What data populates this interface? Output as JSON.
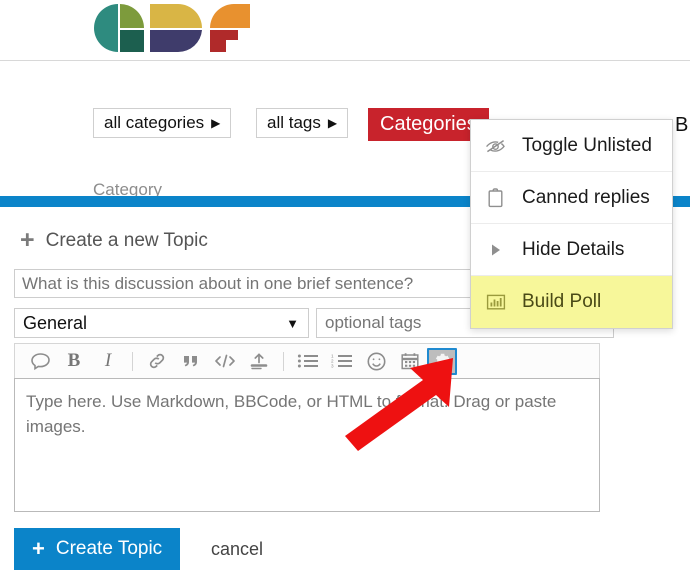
{
  "header": {
    "logo_name": "forum-logo",
    "logo_colors": [
      "#2e8b7f",
      "#7d9b3c",
      "#d9b545",
      "#e8912f",
      "#3f3c6b",
      "#b02a2a",
      "#1c5f4f"
    ]
  },
  "filter_bar": {
    "all_categories": {
      "label": "all categories",
      "caret": "▶"
    },
    "all_tags": {
      "label": "all tags",
      "caret": "▶"
    },
    "active_tab": {
      "label": "Categories",
      "color": "#c8232c"
    },
    "next_tab_partial": "B"
  },
  "list_header": {
    "category_label": "Category"
  },
  "composer": {
    "accent_color": "#0b84c9",
    "heading": "Create a new Topic",
    "heading_plus": "+",
    "title_input": {
      "value": "",
      "placeholder": "What is this discussion about in one brief sentence?"
    },
    "category_select": {
      "value": "General",
      "caret": "▼"
    },
    "tags_input": {
      "value": "",
      "placeholder": "optional tags"
    },
    "editor": {
      "value": "",
      "placeholder": "Type here. Use Markdown, BBCode, or HTML to format. Drag or paste images."
    },
    "toolbar": [
      {
        "name": "quote-bubble-icon",
        "title": "blockquote bubble"
      },
      {
        "name": "bold-icon",
        "title": "Bold",
        "glyph": "B"
      },
      {
        "name": "italic-icon",
        "title": "Italic",
        "glyph": "I"
      },
      {
        "name": "link-icon",
        "title": "Link"
      },
      {
        "name": "quote-icon",
        "title": "Quote"
      },
      {
        "name": "code-icon",
        "title": "Code"
      },
      {
        "name": "upload-icon",
        "title": "Upload"
      },
      {
        "name": "bulleted-list-icon",
        "title": "Bulleted list"
      },
      {
        "name": "numbered-list-icon",
        "title": "Numbered list"
      },
      {
        "name": "emoji-icon",
        "title": "Emoji"
      },
      {
        "name": "calendar-icon",
        "title": "Calendar"
      },
      {
        "name": "gear-icon",
        "title": "Options",
        "active": true
      }
    ],
    "create_button": {
      "label": "Create Topic",
      "plus": "+"
    },
    "cancel_button": {
      "label": "cancel"
    }
  },
  "gear_menu": {
    "items": [
      {
        "icon": "eye-slash-icon",
        "label": "Toggle Unlisted",
        "highlighted": false
      },
      {
        "icon": "clipboard-icon",
        "label": "Canned replies",
        "highlighted": false
      },
      {
        "icon": "triangle-right-icon",
        "label": "Hide Details",
        "highlighted": false
      },
      {
        "icon": "poll-chart-icon",
        "label": "Build Poll",
        "highlighted": true
      }
    ],
    "highlight_color": "#f7f79a"
  },
  "annotation": {
    "arrow_color": "#ee1111",
    "points_to": "gear-icon"
  }
}
